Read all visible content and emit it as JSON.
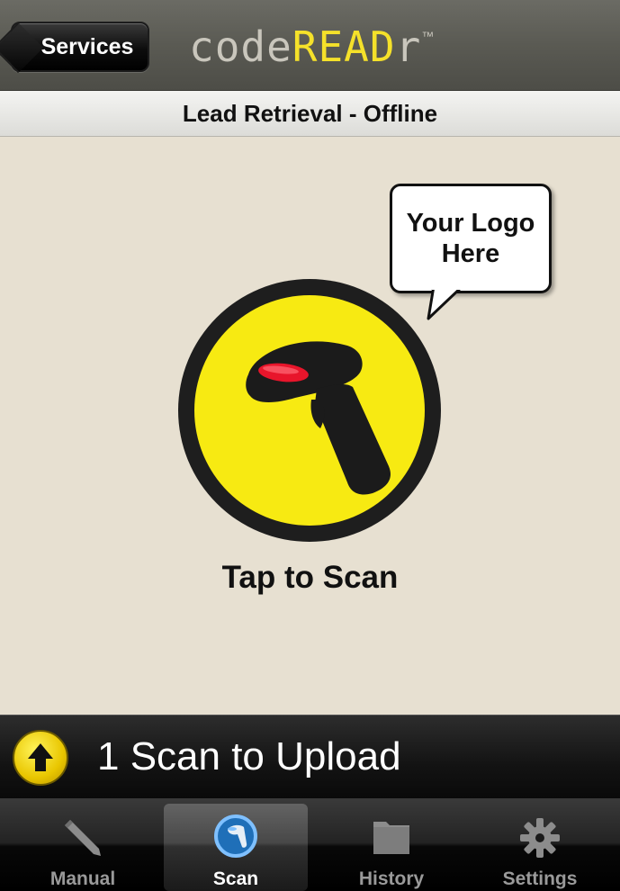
{
  "header": {
    "back_label": "Services",
    "logo": {
      "part1": "code",
      "part2": "READ",
      "part3": "r",
      "tm": "™"
    }
  },
  "subtitle": "Lead Retrieval - Offline",
  "main": {
    "bubble_line1": "Your Logo",
    "bubble_line2": "Here",
    "tap_label": "Tap to Scan"
  },
  "upload": {
    "label": "1 Scan to Upload"
  },
  "tabs": [
    {
      "label": "Manual",
      "icon": "pencil-icon",
      "active": false
    },
    {
      "label": "Scan",
      "icon": "barcode-scanner-icon",
      "active": true
    },
    {
      "label": "History",
      "icon": "folder-icon",
      "active": false
    },
    {
      "label": "Settings",
      "icon": "gear-icon",
      "active": false
    }
  ],
  "colors": {
    "accent_yellow": "#f7ea12",
    "background": "#e7e0d1",
    "navbar": "#5a5a53"
  }
}
